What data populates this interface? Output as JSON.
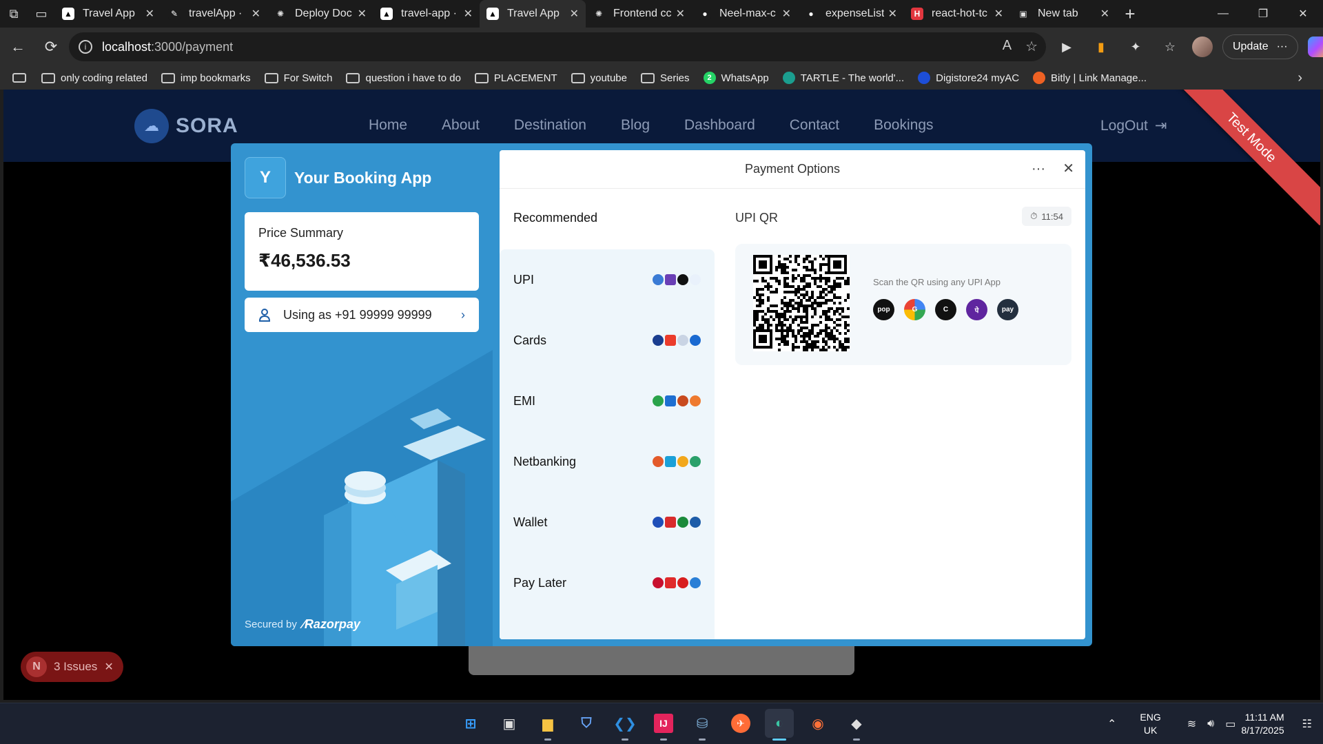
{
  "browser": {
    "tabs": [
      {
        "title": "Travel App",
        "icon": "triangle-icon",
        "active": false
      },
      {
        "title": "travelApp ·",
        "icon": "vercel-brush-icon",
        "active": false
      },
      {
        "title": "Deploy Doc",
        "icon": "openai-icon",
        "active": false
      },
      {
        "title": "travel-app ·",
        "icon": "triangle-icon",
        "active": false
      },
      {
        "title": "Travel App",
        "icon": "triangle-icon",
        "active": true
      },
      {
        "title": "Frontend cc",
        "icon": "openai-icon",
        "active": false
      },
      {
        "title": "Neel-max-c",
        "icon": "github-icon",
        "active": false
      },
      {
        "title": "expenseList",
        "icon": "github-icon",
        "active": false
      },
      {
        "title": "react-hot-tc",
        "icon": "hot-toast-icon",
        "active": false
      },
      {
        "title": "New tab",
        "icon": "new-tab-icon",
        "active": false
      }
    ],
    "url_host": "localhost",
    "url_path": ":3000/payment",
    "update_label": "Update",
    "bookmarks": [
      {
        "label": "only coding  related",
        "type": "folder"
      },
      {
        "label": "imp bookmarks",
        "type": "folder"
      },
      {
        "label": "For Switch",
        "type": "folder"
      },
      {
        "label": "question i have to do",
        "type": "folder"
      },
      {
        "label": "PLACEMENT",
        "type": "folder"
      },
      {
        "label": "youtube",
        "type": "folder"
      },
      {
        "label": "Series",
        "type": "folder"
      },
      {
        "label": "WhatsApp",
        "type": "whatsapp",
        "badge": "2"
      },
      {
        "label": "TARTLE - The world'...",
        "type": "tartle"
      },
      {
        "label": "Digistore24 myAC",
        "type": "digistore"
      },
      {
        "label": "Bitly | Link Manage...",
        "type": "bitly"
      }
    ]
  },
  "site": {
    "brand": "SORA",
    "nav": [
      "Home",
      "About",
      "Destination",
      "Blog",
      "Dashboard",
      "Contact",
      "Bookings"
    ],
    "logout": "LogOut",
    "ribbon": "Test Mode",
    "issues_badge": "N",
    "issues_label": "3 Issues"
  },
  "checkout": {
    "merchant_initial": "Y",
    "merchant_name": "Your Booking App",
    "price_label": "Price Summary",
    "price_amount": "₹46,536.53",
    "user_label": "Using as +91 99999 99999",
    "secured_by": "Secured by",
    "razorpay": "Razorpay",
    "header_title": "Payment Options",
    "recommended_label": "Recommended",
    "methods": [
      {
        "label": "UPI",
        "colors": [
          "#3a7bd5",
          "#6a3fb5",
          "#111111",
          "#e9f1fb"
        ]
      },
      {
        "label": "Cards",
        "colors": [
          "#1a3d8f",
          "#eb3c2b",
          "#c9d4e4",
          "#1a6ad1"
        ]
      },
      {
        "label": "EMI",
        "colors": [
          "#2aa34a",
          "#1e6fd1",
          "#c84a1e",
          "#ee7a2f"
        ]
      },
      {
        "label": "Netbanking",
        "colors": [
          "#e35a2a",
          "#1aa0d8",
          "#f2a71b",
          "#2aa06a"
        ]
      },
      {
        "label": "Wallet",
        "colors": [
          "#1f4fb8",
          "#d92b2b",
          "#1a8a3a",
          "#1d5ca8"
        ]
      },
      {
        "label": "Pay Later",
        "colors": [
          "#c8102e",
          "#e02a2a",
          "#d81e1e",
          "#2a7fd6"
        ]
      }
    ],
    "qr_title": "UPI QR",
    "timer": "11:54",
    "qr_hint": "Scan the QR using any UPI App",
    "upi_apps": [
      {
        "name": "pop",
        "color": "#111111"
      },
      {
        "name": "gpay",
        "color": "#ffffff"
      },
      {
        "name": "cred",
        "color": "#111111"
      },
      {
        "name": "phonepe",
        "color": "#5f259f"
      },
      {
        "name": "amazonpay",
        "color": "#232f3e"
      }
    ]
  },
  "taskbar": {
    "lang_top": "ENG",
    "lang_bottom": "UK",
    "time": "11:11 AM",
    "date": "8/17/2025",
    "apps": [
      "windows-start-icon",
      "widgets-icon",
      "file-explorer-icon",
      "repo-icon",
      "vscode-icon",
      "intellij-icon",
      "mysql-icon",
      "postman-icon",
      "edge-icon",
      "firefox-icon",
      "git-icon"
    ]
  }
}
